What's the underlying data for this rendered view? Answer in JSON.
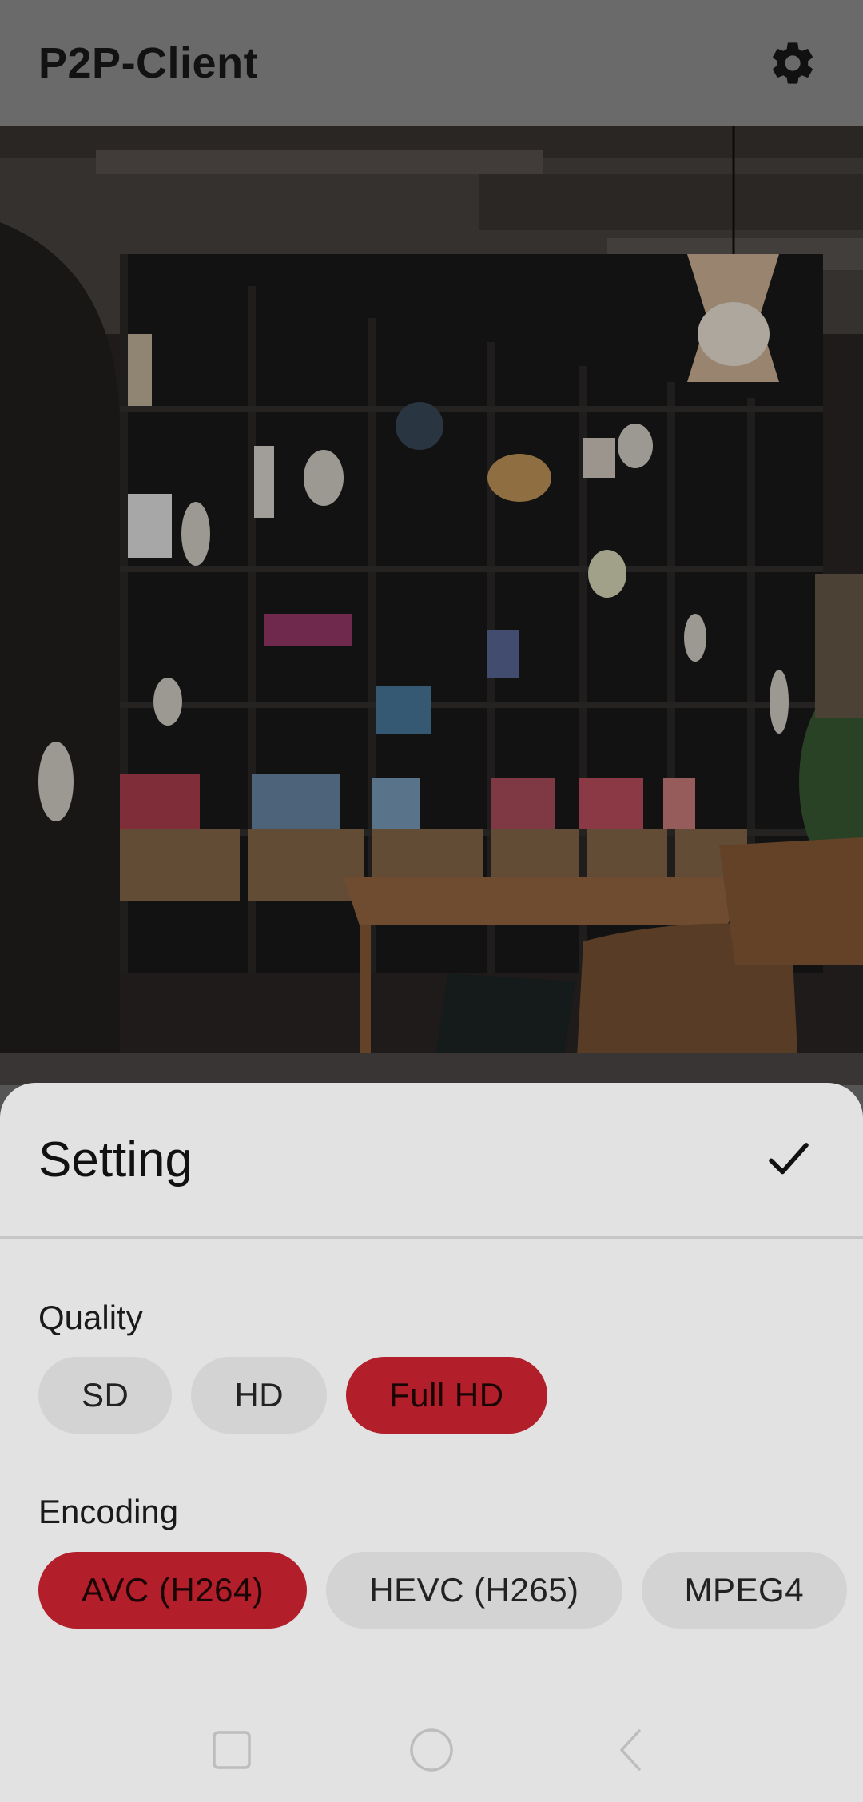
{
  "app_bar": {
    "title": "P2P-Client",
    "settings_icon": "gear-icon"
  },
  "camera": {
    "description_icon": "live-video-feed"
  },
  "sheet": {
    "title": "Setting",
    "confirm_icon": "check-icon",
    "quality": {
      "label": "Quality",
      "options": [
        "SD",
        "HD",
        "Full HD"
      ],
      "selected": "Full HD"
    },
    "encoding": {
      "label": "Encoding",
      "options": [
        "AVC (H264)",
        "HEVC (H265)",
        "MPEG4"
      ],
      "selected": "AVC (H264)"
    }
  },
  "colors": {
    "accent": "#b21e2a",
    "chip_bg": "#d3d3d3",
    "sheet_bg": "#e2e2e2"
  },
  "nav": {
    "recents_icon": "square-icon",
    "home_icon": "circle-icon",
    "back_icon": "back-chevron-icon"
  }
}
